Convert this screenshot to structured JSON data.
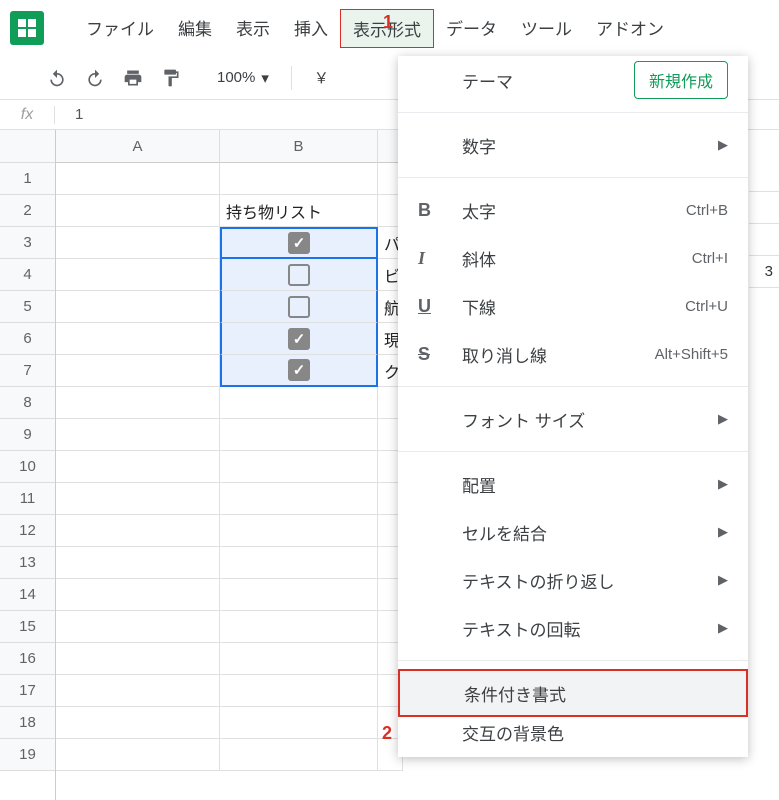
{
  "menubar": {
    "file": "ファイル",
    "edit": "編集",
    "view": "表示",
    "insert": "挿入",
    "format": "表示形式",
    "data": "データ",
    "tools": "ツール",
    "addons": "アドオン"
  },
  "annotations": {
    "one": "1",
    "two": "2"
  },
  "toolbar": {
    "zoom": "100%",
    "currency": "￥"
  },
  "formula": {
    "fx": "fx",
    "value": "1"
  },
  "columns": [
    "A",
    "B"
  ],
  "rows": [
    "1",
    "2",
    "3",
    "4",
    "5",
    "6",
    "7",
    "8",
    "9",
    "10",
    "11",
    "12",
    "13",
    "14",
    "15",
    "16",
    "17",
    "18",
    "19"
  ],
  "cells": {
    "b2": "持ち物リスト",
    "c3": "パ",
    "c4": "ビ",
    "c5": "航",
    "c6": "現",
    "c7": "ク"
  },
  "checkboxes": {
    "b3": true,
    "b4": false,
    "b5": false,
    "b6": true,
    "b7": true
  },
  "right_edge": {
    "row3": "3"
  },
  "dropdown": {
    "theme": "テーマ",
    "new_btn": "新規作成",
    "number": "数字",
    "bold": "太字",
    "bold_sc": "Ctrl+B",
    "italic": "斜体",
    "italic_sc": "Ctrl+I",
    "underline": "下線",
    "underline_sc": "Ctrl+U",
    "strike": "取り消し線",
    "strike_sc": "Alt+Shift+5",
    "fontsize": "フォント サイズ",
    "align": "配置",
    "merge": "セルを結合",
    "wrap": "テキストの折り返し",
    "rotate": "テキストの回転",
    "cond": "条件付き書式",
    "altcolor": "交互の背景色",
    "icon_B": "B",
    "icon_I": "I",
    "icon_U": "U",
    "icon_S": "S"
  }
}
